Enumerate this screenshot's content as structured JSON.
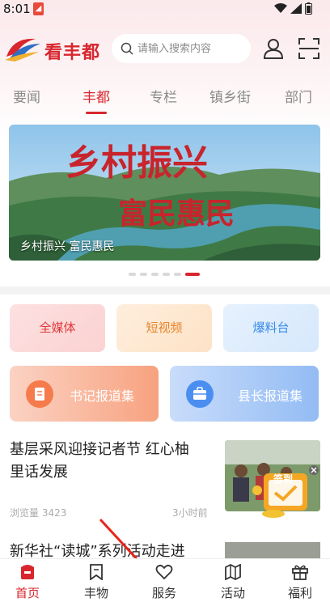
{
  "status_bar": {
    "time": "8:01"
  },
  "header": {
    "logo_text": "看丰都",
    "search_placeholder": "请输入搜索内容"
  },
  "tabs": [
    {
      "label": "要闻",
      "active": false
    },
    {
      "label": "丰都",
      "active": true
    },
    {
      "label": "专栏",
      "active": false
    },
    {
      "label": "镇乡街",
      "active": false
    },
    {
      "label": "部门",
      "active": false
    }
  ],
  "banner": {
    "headline1": "乡村振兴",
    "headline2": "富民惠民",
    "caption": "乡村振兴 富民惠民",
    "slide_count": 6,
    "active_slide": 6
  },
  "quick_buttons": [
    {
      "label": "全媒体"
    },
    {
      "label": "短视频"
    },
    {
      "label": "爆料台"
    }
  ],
  "report_buttons": [
    {
      "label": "书记报道集"
    },
    {
      "label": "县长报道集"
    }
  ],
  "news": [
    {
      "title_line1": "基层采风迎接记者节 红心柚",
      "title_line2": "里话发展",
      "views_label": "浏览量",
      "views": "3423",
      "time": "3小时前"
    },
    {
      "title": "新华社“读城”系列活动走进"
    }
  ],
  "signin_badge": {
    "label": "签到"
  },
  "bottom_nav": [
    {
      "label": "首页",
      "icon": "home-icon",
      "active": true
    },
    {
      "label": "丰物",
      "icon": "bookmark-icon",
      "active": false
    },
    {
      "label": "服务",
      "icon": "heart-icon",
      "active": false
    },
    {
      "label": "活动",
      "icon": "map-icon",
      "active": false
    },
    {
      "label": "福利",
      "icon": "gift-icon",
      "active": false
    }
  ],
  "colors": {
    "brand_red": "#d8262e",
    "orange": "#e8832a",
    "blue": "#3a8ce8"
  }
}
